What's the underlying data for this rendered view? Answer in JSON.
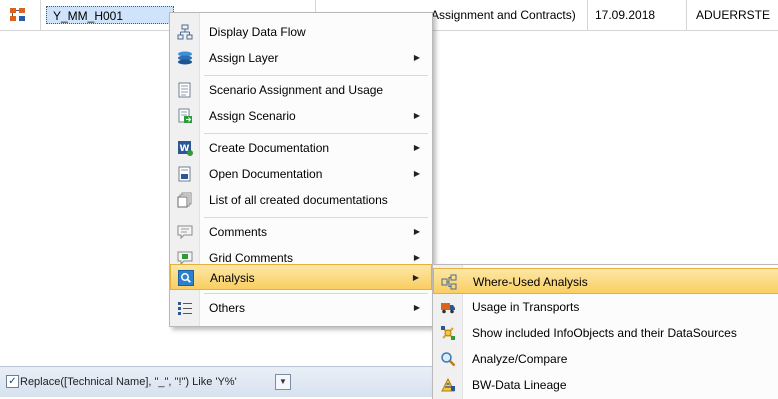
{
  "grid": {
    "row": {
      "technical_name": "Y_MM_H001",
      "description_fragment": "Assignment and Contracts)",
      "date": "17.09.2018",
      "user": "ADUERRSTE"
    }
  },
  "filter": {
    "checked": "✓",
    "expression": "Replace([Technical Name], \"_\", \"!\") Like 'Y%'",
    "dropdown_glyph": "▼"
  },
  "context_menu": {
    "items": [
      {
        "label": "Display Data Flow",
        "icon": "data-flow-icon",
        "submenu": false
      },
      {
        "label": "Assign Layer",
        "icon": "layer-icon",
        "submenu": true
      },
      {
        "label": "Scenario Assignment and Usage",
        "icon": "scenario-icon",
        "submenu": false
      },
      {
        "label": "Assign Scenario",
        "icon": "assign-scenario-icon",
        "submenu": true
      },
      {
        "label": "Create Documentation",
        "icon": "create-doc-icon",
        "submenu": true
      },
      {
        "label": "Open Documentation",
        "icon": "open-doc-icon",
        "submenu": true
      },
      {
        "label": "List of all created documentations",
        "icon": "doc-list-icon",
        "submenu": false
      },
      {
        "label": "Comments",
        "icon": "comment-icon",
        "submenu": true
      },
      {
        "label": "Grid Comments",
        "icon": "grid-comment-icon",
        "submenu": true
      },
      {
        "label": "Analysis",
        "icon": "analysis-icon",
        "submenu": true,
        "highlighted": true
      },
      {
        "label": "Others",
        "icon": "list-icon",
        "submenu": true
      }
    ],
    "submenu_arrow": "▶"
  },
  "analysis_submenu": {
    "items": [
      {
        "label": "Where-Used Analysis",
        "icon": "where-used-icon",
        "highlighted": true
      },
      {
        "label": "Usage in Transports",
        "icon": "transport-icon"
      },
      {
        "label": "Show included InfoObjects and their DataSources",
        "icon": "infoobjects-icon"
      },
      {
        "label": "Analyze/Compare",
        "icon": "magnifier-icon"
      },
      {
        "label": "BW-Data Lineage",
        "icon": "lineage-icon"
      }
    ]
  },
  "colors": {
    "highlight": "#f9cf62",
    "selection": "#cfe3fb",
    "menu_bg": "#fcfcfc"
  }
}
